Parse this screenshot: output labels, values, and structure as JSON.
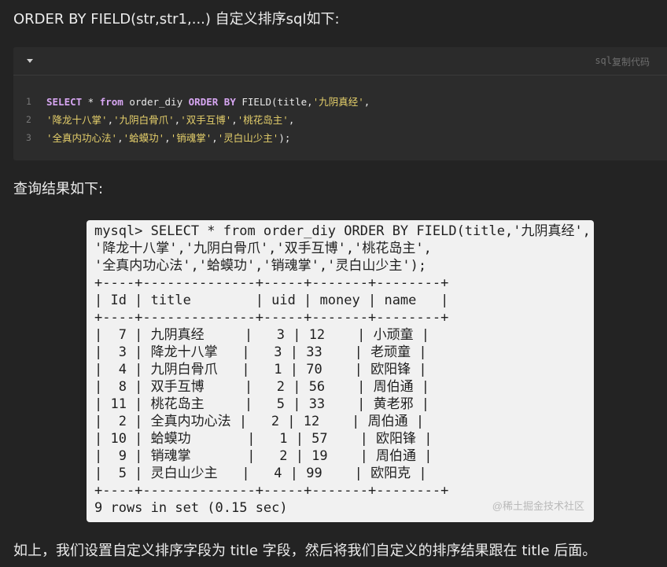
{
  "intro_text": "ORDER BY FIELD(str,str1,...) 自定义排序sql如下:",
  "code_block": {
    "language": "sql",
    "copy_label": "复制代码",
    "lines": [
      {
        "number": "1",
        "tokens": [
          {
            "t": "kw",
            "v": "SELECT"
          },
          {
            "t": "plain",
            "v": " * "
          },
          {
            "t": "kw",
            "v": "from"
          },
          {
            "t": "plain",
            "v": " order_diy "
          },
          {
            "t": "kw",
            "v": "ORDER BY"
          },
          {
            "t": "plain",
            "v": " FIELD(title,"
          },
          {
            "t": "str",
            "v": "'九阴真经'"
          },
          {
            "t": "plain",
            "v": ","
          }
        ]
      },
      {
        "number": "2",
        "tokens": [
          {
            "t": "str",
            "v": "'降龙十八掌'"
          },
          {
            "t": "plain",
            "v": ","
          },
          {
            "t": "str",
            "v": "'九阴白骨爪'"
          },
          {
            "t": "plain",
            "v": ","
          },
          {
            "t": "str",
            "v": "'双手互博'"
          },
          {
            "t": "plain",
            "v": ","
          },
          {
            "t": "str",
            "v": "'桃花岛主'"
          },
          {
            "t": "plain",
            "v": ","
          }
        ]
      },
      {
        "number": "3",
        "tokens": [
          {
            "t": "str",
            "v": "'全真内功心法'"
          },
          {
            "t": "plain",
            "v": ","
          },
          {
            "t": "str",
            "v": "'蛤蟆功'"
          },
          {
            "t": "plain",
            "v": ","
          },
          {
            "t": "str",
            "v": "'销魂掌'"
          },
          {
            "t": "plain",
            "v": ","
          },
          {
            "t": "str",
            "v": "'灵白山少主'"
          },
          {
            "t": "plain",
            "v": ");"
          }
        ]
      }
    ]
  },
  "result_text": "查询结果如下:",
  "terminal": {
    "query_lines": [
      "mysql> SELECT * from order_diy ORDER BY FIELD(title,'九阴真经',",
      "'降龙十八掌','九阴白骨爪','双手互博','桃花岛主',",
      "'全真内功心法','蛤蟆功','销魂掌','灵白山少主');"
    ],
    "border": "+----+--------------+-----+-------+--------+",
    "columns": [
      "Id",
      "title",
      "uid",
      "money",
      "name"
    ],
    "rows": [
      [
        "7",
        "九阴真经",
        "3",
        "12",
        "小顽童"
      ],
      [
        "3",
        "降龙十八掌",
        "3",
        "33",
        "老顽童"
      ],
      [
        "4",
        "九阴白骨爪",
        "1",
        "70",
        "欧阳锋"
      ],
      [
        "8",
        "双手互博",
        "2",
        "56",
        "周伯通"
      ],
      [
        "11",
        "桃花岛主",
        "5",
        "33",
        "黄老邪"
      ],
      [
        "2",
        "全真内功心法",
        "2",
        "12",
        "周伯通"
      ],
      [
        "10",
        "蛤蟆功",
        "1",
        "57",
        "欧阳锋"
      ],
      [
        "9",
        "销魂掌",
        "2",
        "19",
        "周伯通"
      ],
      [
        "5",
        "灵白山少主",
        "4",
        "99",
        "欧阳克"
      ]
    ],
    "footer": "9 rows in set (0.15 sec)",
    "watermark": "@稀土掘金技术社区"
  },
  "outro_text": "如上，我们设置自定义排序字段为 title 字段，然后将我们自定义的排序结果跟在 title 后面。"
}
